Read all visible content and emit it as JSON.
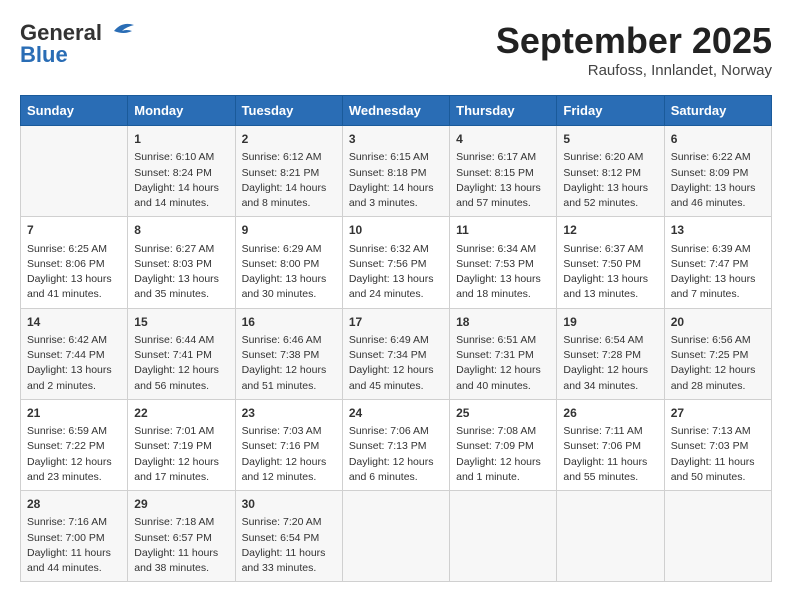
{
  "header": {
    "logo_general": "General",
    "logo_blue": "Blue",
    "month_title": "September 2025",
    "subtitle": "Raufoss, Innlandet, Norway"
  },
  "days_of_week": [
    "Sunday",
    "Monday",
    "Tuesday",
    "Wednesday",
    "Thursday",
    "Friday",
    "Saturday"
  ],
  "weeks": [
    [
      {
        "day": "",
        "info": ""
      },
      {
        "day": "1",
        "info": "Sunrise: 6:10 AM\nSunset: 8:24 PM\nDaylight: 14 hours\nand 14 minutes."
      },
      {
        "day": "2",
        "info": "Sunrise: 6:12 AM\nSunset: 8:21 PM\nDaylight: 14 hours\nand 8 minutes."
      },
      {
        "day": "3",
        "info": "Sunrise: 6:15 AM\nSunset: 8:18 PM\nDaylight: 14 hours\nand 3 minutes."
      },
      {
        "day": "4",
        "info": "Sunrise: 6:17 AM\nSunset: 8:15 PM\nDaylight: 13 hours\nand 57 minutes."
      },
      {
        "day": "5",
        "info": "Sunrise: 6:20 AM\nSunset: 8:12 PM\nDaylight: 13 hours\nand 52 minutes."
      },
      {
        "day": "6",
        "info": "Sunrise: 6:22 AM\nSunset: 8:09 PM\nDaylight: 13 hours\nand 46 minutes."
      }
    ],
    [
      {
        "day": "7",
        "info": "Sunrise: 6:25 AM\nSunset: 8:06 PM\nDaylight: 13 hours\nand 41 minutes."
      },
      {
        "day": "8",
        "info": "Sunrise: 6:27 AM\nSunset: 8:03 PM\nDaylight: 13 hours\nand 35 minutes."
      },
      {
        "day": "9",
        "info": "Sunrise: 6:29 AM\nSunset: 8:00 PM\nDaylight: 13 hours\nand 30 minutes."
      },
      {
        "day": "10",
        "info": "Sunrise: 6:32 AM\nSunset: 7:56 PM\nDaylight: 13 hours\nand 24 minutes."
      },
      {
        "day": "11",
        "info": "Sunrise: 6:34 AM\nSunset: 7:53 PM\nDaylight: 13 hours\nand 18 minutes."
      },
      {
        "day": "12",
        "info": "Sunrise: 6:37 AM\nSunset: 7:50 PM\nDaylight: 13 hours\nand 13 minutes."
      },
      {
        "day": "13",
        "info": "Sunrise: 6:39 AM\nSunset: 7:47 PM\nDaylight: 13 hours\nand 7 minutes."
      }
    ],
    [
      {
        "day": "14",
        "info": "Sunrise: 6:42 AM\nSunset: 7:44 PM\nDaylight: 13 hours\nand 2 minutes."
      },
      {
        "day": "15",
        "info": "Sunrise: 6:44 AM\nSunset: 7:41 PM\nDaylight: 12 hours\nand 56 minutes."
      },
      {
        "day": "16",
        "info": "Sunrise: 6:46 AM\nSunset: 7:38 PM\nDaylight: 12 hours\nand 51 minutes."
      },
      {
        "day": "17",
        "info": "Sunrise: 6:49 AM\nSunset: 7:34 PM\nDaylight: 12 hours\nand 45 minutes."
      },
      {
        "day": "18",
        "info": "Sunrise: 6:51 AM\nSunset: 7:31 PM\nDaylight: 12 hours\nand 40 minutes."
      },
      {
        "day": "19",
        "info": "Sunrise: 6:54 AM\nSunset: 7:28 PM\nDaylight: 12 hours\nand 34 minutes."
      },
      {
        "day": "20",
        "info": "Sunrise: 6:56 AM\nSunset: 7:25 PM\nDaylight: 12 hours\nand 28 minutes."
      }
    ],
    [
      {
        "day": "21",
        "info": "Sunrise: 6:59 AM\nSunset: 7:22 PM\nDaylight: 12 hours\nand 23 minutes."
      },
      {
        "day": "22",
        "info": "Sunrise: 7:01 AM\nSunset: 7:19 PM\nDaylight: 12 hours\nand 17 minutes."
      },
      {
        "day": "23",
        "info": "Sunrise: 7:03 AM\nSunset: 7:16 PM\nDaylight: 12 hours\nand 12 minutes."
      },
      {
        "day": "24",
        "info": "Sunrise: 7:06 AM\nSunset: 7:13 PM\nDaylight: 12 hours\nand 6 minutes."
      },
      {
        "day": "25",
        "info": "Sunrise: 7:08 AM\nSunset: 7:09 PM\nDaylight: 12 hours\nand 1 minute."
      },
      {
        "day": "26",
        "info": "Sunrise: 7:11 AM\nSunset: 7:06 PM\nDaylight: 11 hours\nand 55 minutes."
      },
      {
        "day": "27",
        "info": "Sunrise: 7:13 AM\nSunset: 7:03 PM\nDaylight: 11 hours\nand 50 minutes."
      }
    ],
    [
      {
        "day": "28",
        "info": "Sunrise: 7:16 AM\nSunset: 7:00 PM\nDaylight: 11 hours\nand 44 minutes."
      },
      {
        "day": "29",
        "info": "Sunrise: 7:18 AM\nSunset: 6:57 PM\nDaylight: 11 hours\nand 38 minutes."
      },
      {
        "day": "30",
        "info": "Sunrise: 7:20 AM\nSunset: 6:54 PM\nDaylight: 11 hours\nand 33 minutes."
      },
      {
        "day": "",
        "info": ""
      },
      {
        "day": "",
        "info": ""
      },
      {
        "day": "",
        "info": ""
      },
      {
        "day": "",
        "info": ""
      }
    ]
  ]
}
